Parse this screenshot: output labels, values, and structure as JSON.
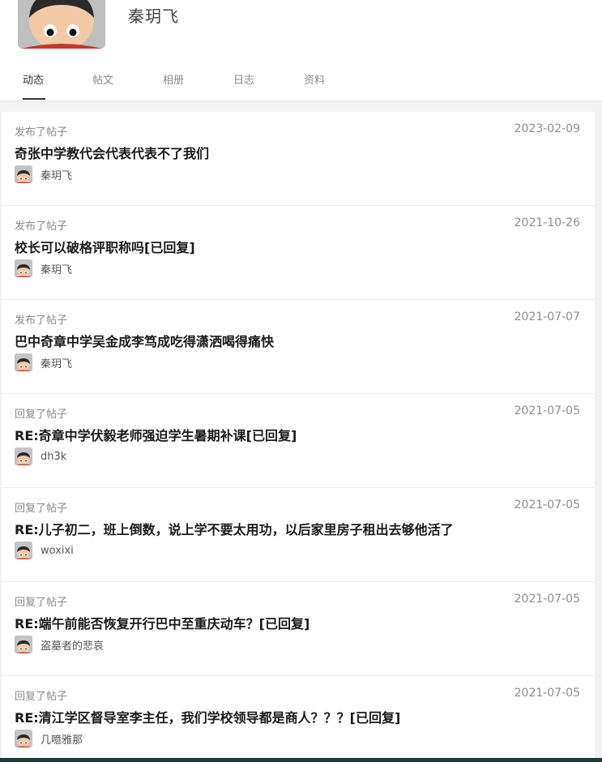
{
  "profile": {
    "name": "秦玥飞"
  },
  "tabs": [
    {
      "label": "动态",
      "active": true
    },
    {
      "label": "帖文",
      "active": false
    },
    {
      "label": "相册",
      "active": false
    },
    {
      "label": "日志",
      "active": false
    },
    {
      "label": "资料",
      "active": false
    }
  ],
  "feed": [
    {
      "action": "发布了帖子",
      "date": "2023-02-09",
      "title": "奇张中学教代会代表代表不了我们",
      "author": "秦玥飞"
    },
    {
      "action": "发布了帖子",
      "date": "2021-10-26",
      "title": "校长可以破格评职称吗[已回复]",
      "author": "秦玥飞"
    },
    {
      "action": "发布了帖子",
      "date": "2021-07-07",
      "title": "巴中奇章中学吴金成李笃成吃得潇洒喝得痛快",
      "author": "秦玥飞"
    },
    {
      "action": "回复了帖子",
      "date": "2021-07-05",
      "title": "RE:奇章中学伏毅老师强迫学生暑期补课[已回复]",
      "author": "dh3k"
    },
    {
      "action": "回复了帖子",
      "date": "2021-07-05",
      "title": "RE:儿子初二，班上倒数，说上学不要太用功，以后家里房子租出去够他活了",
      "author": "woxixi"
    },
    {
      "action": "回复了帖子",
      "date": "2021-07-05",
      "title": "RE:端午前能否恢复开行巴中至重庆动车？[已回复]",
      "author": "盗墓者的悲哀"
    },
    {
      "action": "回复了帖子",
      "date": "2021-07-05",
      "title": "RE:清江学区督导室李主任，我们学校领导都是商人？？？[已回复]",
      "author": "几噫雅那"
    }
  ],
  "colors": {
    "background": "#f2f2f2",
    "card": "#ffffff",
    "text_primary": "#1a1a1a",
    "text_secondary": "#8a8a8a",
    "bottom_bar": "#1e3a3a"
  }
}
